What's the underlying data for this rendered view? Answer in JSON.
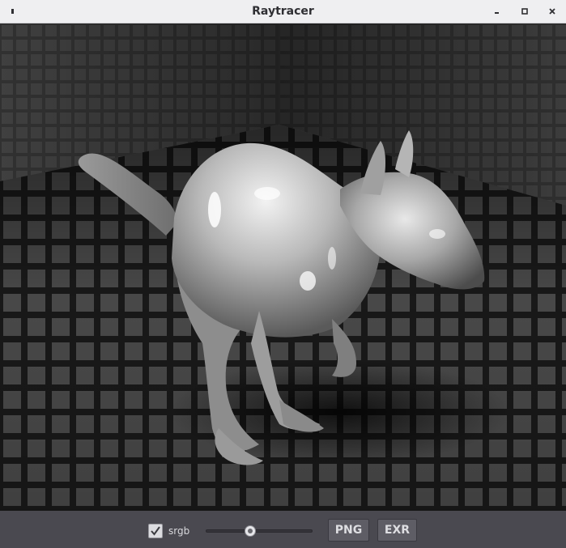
{
  "window": {
    "title": "Raytracer"
  },
  "titlebar_icons": {
    "menu": "window-menu-icon",
    "minimize": "minimize-icon",
    "maximize": "maximize-icon",
    "close": "close-icon"
  },
  "viewport": {
    "subject": "kangaroo-render-icon"
  },
  "toolbar": {
    "srgb_label": "srgb",
    "srgb_checked": true,
    "exposure_slider_value": 0.42,
    "png_label": "PNG",
    "exr_label": "EXR"
  },
  "colors": {
    "titlebar_bg": "#efeff1",
    "toolbar_bg": "#4a4950",
    "button_bg": "#5e5d65",
    "text_light": "#dedee2"
  }
}
